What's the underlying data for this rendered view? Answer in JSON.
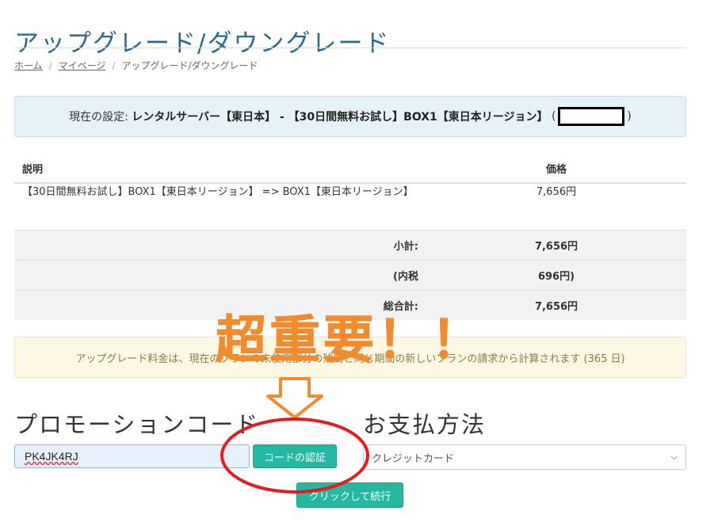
{
  "page": {
    "title": "アップグレード/ダウングレード"
  },
  "breadcrumb": {
    "home": "ホーム",
    "mypage": "マイページ",
    "current": "アップグレード/ダウングレード",
    "separator": "/"
  },
  "current_setting": {
    "label": "現在の設定:",
    "value": "レンタルサーバー【東日本】 - 【30日間無料お試し】BOX1【東日本リージョン】",
    "open_paren": "(",
    "close_paren": ")"
  },
  "invoice": {
    "col_description": "説明",
    "col_price": "価格",
    "item_description": "【30日間無料お試し】BOX1【東日本リージョン】 => BOX1【東日本リージョン】",
    "item_price": "7,656円",
    "subtotal_label": "小計:",
    "subtotal_value": "7,656円",
    "tax_label": "(内税",
    "tax_value": "696円)",
    "total_label": "総合計:",
    "total_value": "7,656円"
  },
  "notice": {
    "text": "アップグレード料金は、現在のプランの未使用部分の残高と同じ期間の新しいプランの請求から計算されます (365 日)"
  },
  "annotation": {
    "text": "超重要！！",
    "color": "#f28a2e",
    "circle_color": "#e31b23"
  },
  "promo": {
    "heading": "プロモーションコード",
    "input_value": "PK4JK4RJ",
    "verify_button": "コードの認証"
  },
  "payment": {
    "heading": "お支払方法",
    "selected": "クレジットカード"
  },
  "actions": {
    "continue_button": "クリックして続行"
  },
  "colors": {
    "accent": "#26b7a0",
    "title": "#2d6a8e",
    "info_bg": "#e6f2f8",
    "notice_bg": "#fcf8e3"
  }
}
